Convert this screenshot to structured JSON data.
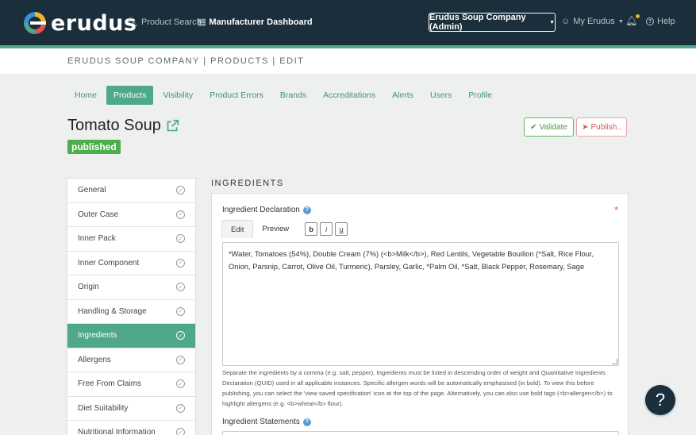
{
  "brand": {
    "name": "erudus"
  },
  "nav": {
    "product_search": "Product Search",
    "manufacturer_dashboard": "Manufacturer Dashboard",
    "company": "Erudus Soup Company (Admin)",
    "my_erudus": "My Erudus",
    "help": "Help"
  },
  "breadcrumb": "ERUDUS SOUP COMPANY | PRODUCTS | EDIT",
  "tabs": [
    {
      "label": "Home"
    },
    {
      "label": "Products"
    },
    {
      "label": "Visibility"
    },
    {
      "label": "Product Errors"
    },
    {
      "label": "Brands"
    },
    {
      "label": "Accreditations"
    },
    {
      "label": "Alerts"
    },
    {
      "label": "Users"
    },
    {
      "label": "Profile"
    }
  ],
  "product": {
    "title": "Tomato Soup",
    "status": "published"
  },
  "actions": {
    "validate": "Validate",
    "publish": "Publish.."
  },
  "sidebar": {
    "items": [
      {
        "label": "General"
      },
      {
        "label": "Outer Case"
      },
      {
        "label": "Inner Pack"
      },
      {
        "label": "Inner Component"
      },
      {
        "label": "Origin"
      },
      {
        "label": "Handling & Storage"
      },
      {
        "label": "Ingredients"
      },
      {
        "label": "Allergens"
      },
      {
        "label": "Free From Claims"
      },
      {
        "label": "Diet Suitability"
      },
      {
        "label": "Nutritional Information"
      }
    ]
  },
  "ingredients": {
    "section_title": "INGREDIENTS",
    "declaration_label": "Ingredient Declaration",
    "edit_tab": "Edit",
    "preview_tab": "Preview",
    "bold_btn": "b",
    "italic_btn": "i",
    "underline_btn": "u",
    "required_mark": "*",
    "declaration_value": "*Water, Tomatoes (54%), Double Cream (7%) (<b>Milk</b>), Red Lentils, Vegetable Bouillon (*Salt, Rice Flour, Onion, Parsnip, Carrot, Olive Oil, Turmeric), Parsley, Garlic, *Palm Oil, *Salt, Black Pepper, Rosemary, Sage",
    "help_text": "Separate the ingredients by a comma (e.g. salt, pepper). Ingredients must be listed in descending order of weight and Quantitative Ingredients Declaration (QUID) used in all applicable instances. Specific allergen words will be automatically emphasised (in bold). To view this before publishing, you can select the 'view saved specification' icon at the top of the page. Alternatively, you can also use bold tags (<b>allergen</b>) to highlight allergens (e.g. <b>wheat</b> flour).",
    "statements_label": "Ingredient Statements"
  },
  "help_fab": "?",
  "colors": {
    "navbar": "#1a2e3b",
    "accent": "#4fa88a",
    "published": "#4cae4c",
    "danger": "#d9534f"
  }
}
